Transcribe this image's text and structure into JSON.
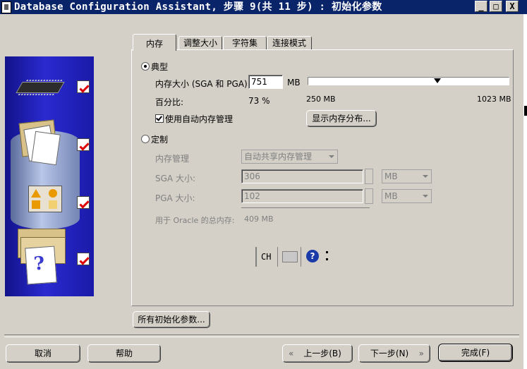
{
  "window": {
    "title": "Database Configuration Assistant, 步骤 9(共 11 步) : 初始化参数",
    "min_label": "_",
    "max_label": "□",
    "close_label": "X"
  },
  "tabs": [
    {
      "label": "内存"
    },
    {
      "label": "调整大小"
    },
    {
      "label": "字符集"
    },
    {
      "label": "连接模式"
    }
  ],
  "typical": {
    "label": "典型",
    "memory_label": "内存大小 (SGA 和 PGA):",
    "memory_value": "751",
    "memory_unit": "MB",
    "slider_min_label": "250 MB",
    "slider_max_label": "1023 MB",
    "slider_fraction": 0.65,
    "percent_label": "百分比:",
    "percent_value": "73 %",
    "auto_mem_label": "使用自动内存管理",
    "show_dist_button": "显示内存分布..."
  },
  "custom": {
    "label": "定制",
    "mem_mgmt_label": "内存管理",
    "mem_mgmt_value": "自动共享内存管理",
    "sga_label": "SGA 大小:",
    "sga_value": "306",
    "sga_unit": "MB",
    "pga_label": "PGA 大小:",
    "pga_value": "102",
    "pga_unit": "MB",
    "total_label": "用于 Oracle 的总内存:",
    "total_value": "409 MB"
  },
  "ime": {
    "lang": "CH",
    "help": "?"
  },
  "all_params_button": "所有初始化参数...",
  "footer": {
    "cancel": "取消",
    "help": "帮助",
    "back": "上一步(B)",
    "next": "下一步(N)",
    "finish": "完成(F)"
  }
}
